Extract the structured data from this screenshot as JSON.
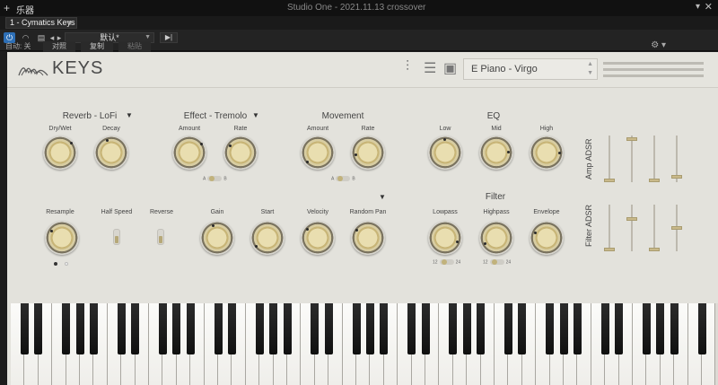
{
  "host": {
    "window_label": "乐器",
    "window_title": "Studio One - 2021.11.13 crossover",
    "instrument_selector": "1 - Cymatics Keys",
    "preset": "默认*",
    "automation": "自动: 关",
    "compare": "对照",
    "copy": "复制",
    "paste": "粘贴"
  },
  "plugin": {
    "name": "KEYS",
    "preset_name": "E Piano - Virgo",
    "sections": {
      "reverb": {
        "title": "Reverb - LoFi",
        "knobs": [
          "Dry/Wet",
          "Decay"
        ]
      },
      "effect": {
        "title": "Effect - Tremolo",
        "knobs": [
          "Amount",
          "Rate"
        ]
      },
      "movement": {
        "title": "Movement",
        "knobs": [
          "Amount",
          "Rate"
        ]
      },
      "eq": {
        "title": "EQ",
        "knobs": [
          "Low",
          "Mid",
          "High"
        ]
      },
      "filter": {
        "title": "Filter"
      }
    },
    "bottom_row": {
      "resample": "Resample",
      "half_speed": "Half Speed",
      "reverse": "Reverse",
      "gain": "Gain",
      "start": "Start",
      "velocity": "Velocity",
      "random_pan": "Random Pan",
      "lowpass": "Lowpass",
      "highpass": "Highpass",
      "envelope": "Envelope"
    },
    "ab_switch": {
      "a": "A",
      "b": "B"
    },
    "slope_switch": {
      "left": "12",
      "right": "24"
    },
    "adsr": {
      "amp": "Amp ADSR",
      "filter": "Filter ADSR"
    }
  },
  "colors": {
    "panel": "#e3e2dc",
    "knob_gold": "#c8b577",
    "toolbar": "#232323",
    "power_blue": "#2d6fb6"
  }
}
